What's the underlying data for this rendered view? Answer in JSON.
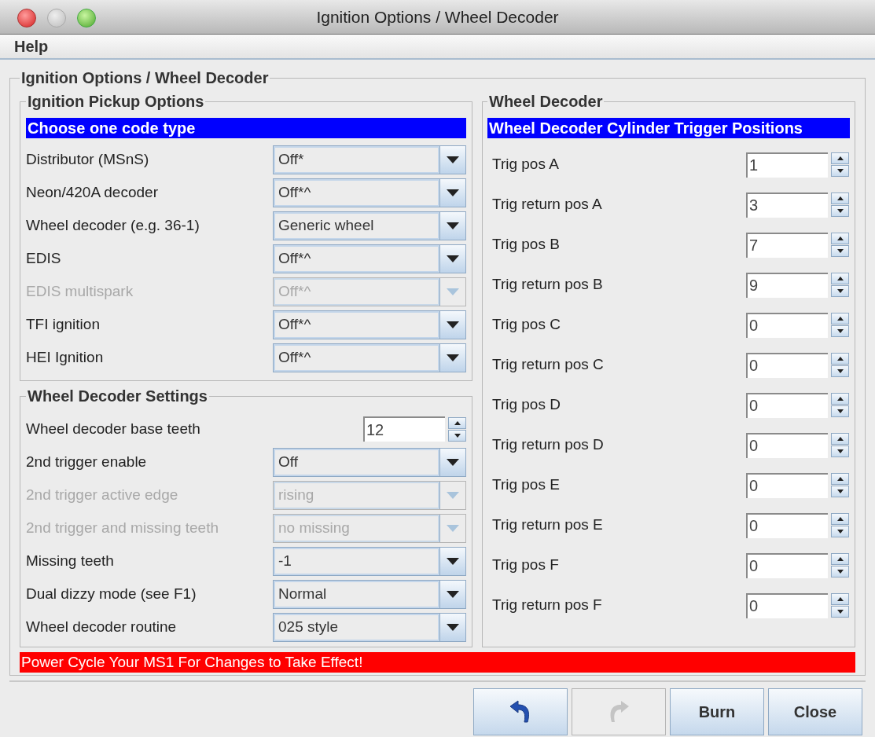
{
  "window": {
    "title": "Ignition Options / Wheel Decoder"
  },
  "menu": [
    {
      "label": "Help"
    }
  ],
  "main_group": {
    "title": "Ignition Options / Wheel Decoder"
  },
  "pickup_options": {
    "title": "Ignition Pickup Options",
    "banner": "Choose one code type",
    "rows": [
      {
        "kind": "combo",
        "label": "Distributor (MSnS)",
        "value": "Off*",
        "disabled": false
      },
      {
        "kind": "combo",
        "label": "Neon/420A decoder",
        "value": "Off*^",
        "disabled": false
      },
      {
        "kind": "combo",
        "label": "Wheel decoder (e.g. 36-1)",
        "value": "Generic wheel",
        "disabled": false
      },
      {
        "kind": "combo",
        "label": "EDIS",
        "value": "Off*^",
        "disabled": false
      },
      {
        "kind": "combo",
        "label": "EDIS multispark",
        "value": "Off*^",
        "disabled": true
      },
      {
        "kind": "combo",
        "label": "TFI ignition",
        "value": "Off*^",
        "disabled": false
      },
      {
        "kind": "combo",
        "label": "HEI Ignition",
        "value": "Off*^",
        "disabled": false
      }
    ]
  },
  "decoder_settings": {
    "title": "Wheel Decoder Settings",
    "rows": [
      {
        "kind": "spinner",
        "label": "Wheel decoder base teeth",
        "value": "12",
        "disabled": false
      },
      {
        "kind": "combo",
        "label": "2nd trigger enable",
        "value": "Off",
        "disabled": false
      },
      {
        "kind": "combo",
        "label": "2nd trigger active edge",
        "value": "rising",
        "disabled": true
      },
      {
        "kind": "combo",
        "label": "2nd trigger and missing teeth",
        "value": "no missing",
        "disabled": true
      },
      {
        "kind": "combo",
        "label": "Missing teeth",
        "value": "-1",
        "disabled": false
      },
      {
        "kind": "combo",
        "label": "Dual dizzy mode (see F1)",
        "value": "Normal",
        "disabled": false
      },
      {
        "kind": "combo",
        "label": "Wheel decoder routine",
        "value": "025 style",
        "disabled": false
      }
    ]
  },
  "wheel_decoder": {
    "title": "Wheel Decoder",
    "banner": "Wheel Decoder Cylinder Trigger Positions",
    "rows": [
      {
        "kind": "spinner",
        "label": "Trig pos A",
        "value": "1",
        "disabled": false
      },
      {
        "kind": "spinner",
        "label": "Trig return pos A",
        "value": "3",
        "disabled": false
      },
      {
        "kind": "spinner",
        "label": "Trig pos B",
        "value": "7",
        "disabled": false
      },
      {
        "kind": "spinner",
        "label": "Trig return pos B",
        "value": "9",
        "disabled": false
      },
      {
        "kind": "spinner",
        "label": "Trig pos C",
        "value": "0",
        "disabled": false
      },
      {
        "kind": "spinner",
        "label": "Trig return pos C",
        "value": "0",
        "disabled": false
      },
      {
        "kind": "spinner",
        "label": "Trig pos D",
        "value": "0",
        "disabled": false
      },
      {
        "kind": "spinner",
        "label": "Trig return pos D",
        "value": "0",
        "disabled": false
      },
      {
        "kind": "spinner",
        "label": "Trig pos E",
        "value": "0",
        "disabled": false
      },
      {
        "kind": "spinner",
        "label": "Trig return pos E",
        "value": "0",
        "disabled": false
      },
      {
        "kind": "spinner",
        "label": "Trig pos F",
        "value": "0",
        "disabled": false
      },
      {
        "kind": "spinner",
        "label": "Trig return pos F",
        "value": "0",
        "disabled": false
      }
    ]
  },
  "warning": "Power Cycle Your MS1 For Changes to Take Effect!",
  "icon_buttons": [
    {
      "kind": "undo",
      "disabled": false
    },
    {
      "kind": "redo",
      "disabled": true
    }
  ],
  "buttons": [
    {
      "label": "Burn"
    },
    {
      "label": "Close"
    }
  ]
}
